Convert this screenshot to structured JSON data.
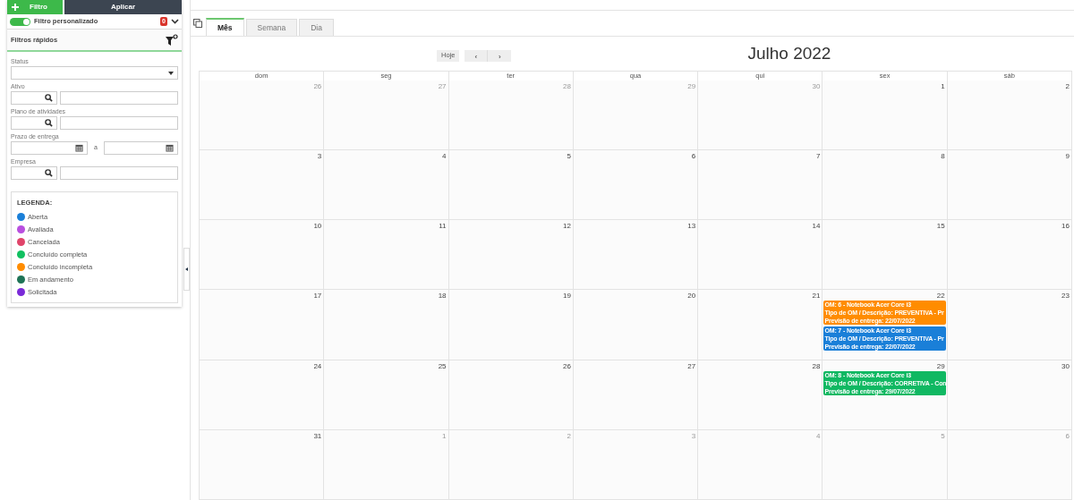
{
  "sidebar": {
    "add_button": "Filtro",
    "apply_button": "Aplicar",
    "custom_filter": {
      "label": "Filtro personalizado",
      "on": true,
      "count": "0"
    },
    "quick_filters": {
      "title": "Filtros rápidos",
      "fields": [
        {
          "kind": "select",
          "label": "Status"
        },
        {
          "kind": "lookup",
          "label": "Ativo"
        },
        {
          "kind": "lookup",
          "label": "Plano de atividades"
        },
        {
          "kind": "date_range",
          "label": "Prazo de entrega",
          "separator": "a"
        },
        {
          "kind": "lookup",
          "label": "Empresa"
        }
      ]
    },
    "legend": {
      "title": "LEGENDA:",
      "items": [
        {
          "label": "Aberta",
          "color": "#1a7fd8"
        },
        {
          "label": "Avaliada",
          "color": "#b84fdf"
        },
        {
          "label": "Cancelada",
          "color": "#e0446a"
        },
        {
          "label": "Concluído completa",
          "color": "#10c060"
        },
        {
          "label": "Concluído incompleta",
          "color": "#ff8c00"
        },
        {
          "label": "Em andamento",
          "color": "#1e7356"
        },
        {
          "label": "Solicitada",
          "color": "#7a2ad8"
        }
      ]
    }
  },
  "tabs": [
    {
      "label": "Mês",
      "selected": true
    },
    {
      "label": "Semana",
      "selected": false
    },
    {
      "label": "Dia",
      "selected": false
    }
  ],
  "toolbar": {
    "today": "Hoje",
    "prev": "‹",
    "next": "›",
    "title": "Julho 2022"
  },
  "calendar": {
    "weekdays": [
      "dom",
      "seg",
      "ter",
      "qua",
      "qui",
      "sex",
      "sáb"
    ],
    "weeks": [
      [
        {
          "day": "26",
          "other_month": true
        },
        {
          "day": "27",
          "other_month": true
        },
        {
          "day": "28",
          "other_month": true
        },
        {
          "day": "29",
          "other_month": true
        },
        {
          "day": "30",
          "other_month": true
        },
        {
          "day": "1",
          "other_month": false
        },
        {
          "day": "2",
          "other_month": false
        }
      ],
      [
        {
          "day": "3",
          "other_month": false
        },
        {
          "day": "4",
          "other_month": false
        },
        {
          "day": "5",
          "other_month": false
        },
        {
          "day": "6",
          "other_month": false
        },
        {
          "day": "7",
          "other_month": false
        },
        {
          "day": "8",
          "other_month": false
        },
        {
          "day": "9",
          "other_month": false
        }
      ],
      [
        {
          "day": "10",
          "other_month": false
        },
        {
          "day": "11",
          "other_month": false
        },
        {
          "day": "12",
          "other_month": false
        },
        {
          "day": "13",
          "other_month": false
        },
        {
          "day": "14",
          "other_month": false
        },
        {
          "day": "15",
          "other_month": false
        },
        {
          "day": "16",
          "other_month": false
        }
      ],
      [
        {
          "day": "17",
          "other_month": false
        },
        {
          "day": "18",
          "other_month": false
        },
        {
          "day": "19",
          "other_month": false
        },
        {
          "day": "20",
          "other_month": false
        },
        {
          "day": "21",
          "other_month": false
        },
        {
          "day": "22",
          "other_month": false,
          "events": [
            {
              "color": "#ff8c00",
              "lines": [
                "OM: 6 - Notebook Acer Core i3",
                "Tipo de OM / Descrição: PREVENTIVA - Pr",
                "Previsão de entrega: 22/07/2022"
              ]
            },
            {
              "color": "#1a7fd8",
              "lines": [
                "OM: 7 - Notebook Acer Core i3",
                "Tipo de OM / Descrição: PREVENTIVA - Pr",
                "Previsão de entrega: 22/07/2022"
              ]
            }
          ]
        },
        {
          "day": "23",
          "other_month": false
        }
      ],
      [
        {
          "day": "24",
          "other_month": false
        },
        {
          "day": "25",
          "other_month": false
        },
        {
          "day": "26",
          "other_month": false
        },
        {
          "day": "27",
          "other_month": false
        },
        {
          "day": "28",
          "other_month": false
        },
        {
          "day": "29",
          "other_month": false,
          "events": [
            {
              "color": "#10b862",
              "lines": [
                "OM: 8 - Notebook Acer Core i3",
                "Tipo de OM / Descrição: CORRETIVA - Con",
                "Previsão de entrega: 29/07/2022"
              ]
            }
          ]
        },
        {
          "day": "30",
          "other_month": false
        }
      ],
      [
        {
          "day": "31",
          "other_month": false
        },
        {
          "day": "1",
          "other_month": true
        },
        {
          "day": "2",
          "other_month": true
        },
        {
          "day": "3",
          "other_month": true
        },
        {
          "day": "4",
          "other_month": true
        },
        {
          "day": "5",
          "other_month": true
        },
        {
          "day": "6",
          "other_month": true
        }
      ]
    ]
  }
}
